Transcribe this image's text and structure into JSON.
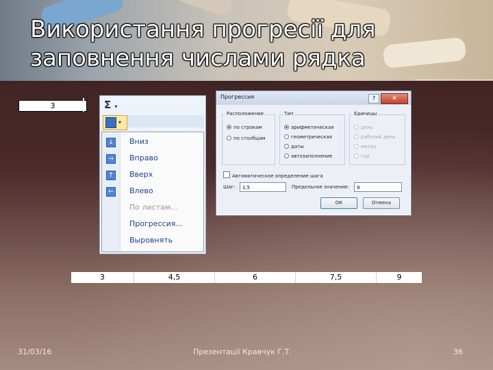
{
  "slide": {
    "title": "Використання прогресії для заповнення числами рядка",
    "bg_color": "#3a1f1f",
    "accent": "#ffffff"
  },
  "start_cell": {
    "value": "3"
  },
  "fill_menu": {
    "sigma_icon": "sigma-icon",
    "items": [
      {
        "label": "Вниз",
        "icon": "arrow-down-icon",
        "enabled": true
      },
      {
        "label": "Вправо",
        "icon": "arrow-right-icon",
        "enabled": true
      },
      {
        "label": "Вверх",
        "icon": "arrow-up-icon",
        "enabled": true
      },
      {
        "label": "Влево",
        "icon": "arrow-left-icon",
        "enabled": true
      },
      {
        "label": "По листам...",
        "icon": "",
        "enabled": false
      },
      {
        "label": "Прогрессия...",
        "icon": "",
        "enabled": true
      },
      {
        "label": "Выровнять",
        "icon": "",
        "enabled": true
      }
    ]
  },
  "dialog": {
    "title": "Прогрессия",
    "help": "?",
    "close": "✕",
    "location": {
      "title": "Расположение",
      "options": [
        "по строкам",
        "по столбцам"
      ],
      "selected": 0
    },
    "type": {
      "title": "Тип",
      "options": [
        "арифметическая",
        "геометрическая",
        "даты",
        "автозаполнение"
      ],
      "selected": 0
    },
    "units": {
      "title": "Единицы",
      "options": [
        "день",
        "рабочий день",
        "месяц",
        "год"
      ],
      "enabled": false
    },
    "auto_step_label": "Автоматическое определение шага",
    "step_label": "Шаг:",
    "step_value": "1,5",
    "limit_label": "Предельное значение:",
    "limit_value": "9",
    "ok_label": "ОК",
    "cancel_label": "Отмена"
  },
  "result_row": [
    "3",
    "4,5",
    "6",
    "7,5",
    "9"
  ],
  "footer": {
    "date": "31/03/16",
    "author": "Презентації Кравчук Г.Т.",
    "page": "36"
  }
}
